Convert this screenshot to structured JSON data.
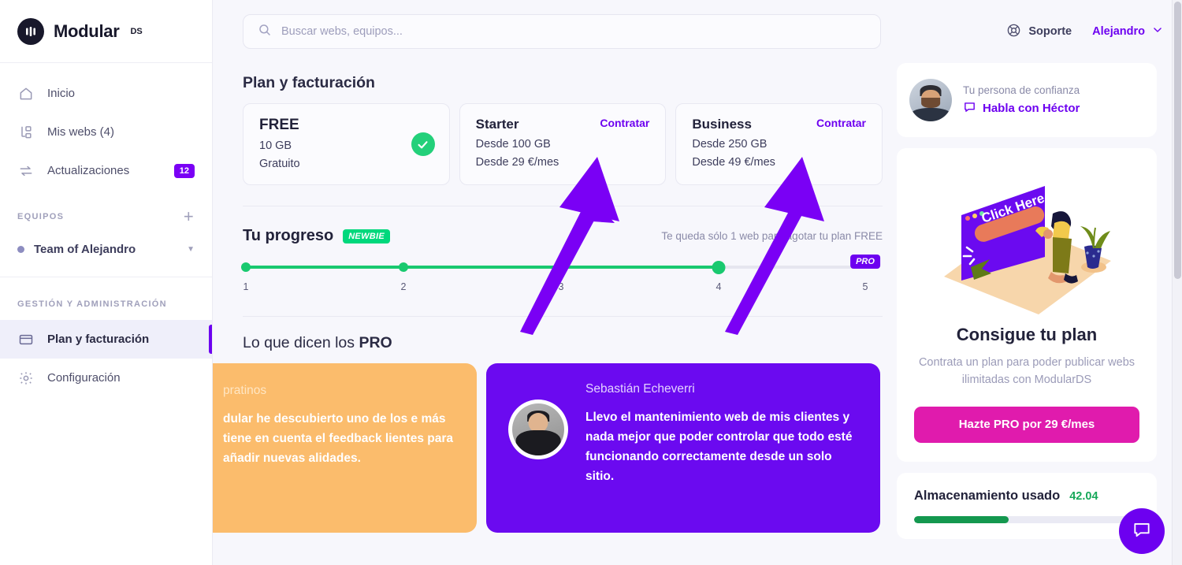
{
  "brand": {
    "name": "Modular",
    "sup": "DS",
    "logo_icon": "modular-logo-icon"
  },
  "sidebar": {
    "nav": [
      {
        "label": "Inicio",
        "icon": "home-icon",
        "badge": null
      },
      {
        "label": "Mis webs (4)",
        "icon": "sites-icon",
        "badge": null
      },
      {
        "label": "Actualizaciones",
        "icon": "updates-icon",
        "badge": "12"
      }
    ],
    "teams_section": {
      "heading": "EQUIPOS",
      "add_icon": "plus-icon"
    },
    "team": {
      "name": "Team of Alejandro",
      "caret_icon": "chevron-down-icon"
    },
    "admin_section": {
      "heading": "GESTIÓN Y ADMINISTRACIÓN"
    },
    "admin_items": [
      {
        "label": "Plan y facturación",
        "icon": "credit-card-icon",
        "active": true
      },
      {
        "label": "Configuración",
        "icon": "gear-icon",
        "active": false
      }
    ]
  },
  "topbar": {
    "search": {
      "placeholder": "Buscar webs, equipos...",
      "value": "",
      "icon": "search-icon"
    },
    "support": {
      "label": "Soporte",
      "icon": "lifebuoy-icon"
    },
    "user": {
      "name": "Alejandro",
      "caret_icon": "chevron-down-icon"
    }
  },
  "billing": {
    "title": "Plan y facturación",
    "plans": [
      {
        "name": "FREE",
        "storage": "10 GB",
        "price": "Gratuito",
        "cta": null,
        "current": true,
        "check_icon": "check-circle-icon"
      },
      {
        "name": "Starter",
        "storage": "Desde 100 GB",
        "price": "Desde 29 €/mes",
        "cta": "Contratar",
        "current": false
      },
      {
        "name": "Business",
        "storage": "Desde 250 GB",
        "price": "Desde 49 €/mes",
        "cta": "Contratar",
        "current": false
      }
    ]
  },
  "progress": {
    "title": "Tu progreso",
    "badge": "NEWBIE",
    "note": "Te queda sólo 1 web para agotar tu plan FREE",
    "steps": [
      "1",
      "2",
      "3",
      "4",
      "5"
    ],
    "current_step": 4,
    "total_steps": 5,
    "pro_badge": "PRO"
  },
  "testimonials": {
    "title_prefix": "Lo que dicen los ",
    "title_strong": "PRO",
    "items": [
      {
        "name": "pratinos",
        "quote": "dular he descubierto uno de los e más tiene en cuenta el feedback lientes para añadir nuevas alidades.",
        "color": "#fbbc6c",
        "clipped": true
      },
      {
        "name": "Sebastián Echeverri",
        "quote": "Llevo el mantenimiento web de mis clientes y nada mejor que poder controlar que todo esté funcionando correctamente desde un solo sitio.",
        "color": "#6b0af0",
        "avatar_icon": "avatar"
      }
    ]
  },
  "aside": {
    "helper": {
      "kicker": "Tu persona de confianza",
      "cta": "Habla con Héctor",
      "chat_icon": "chat-bubble-icon",
      "avatar_icon": "avatar"
    },
    "promo": {
      "illustration_label": "Click Here",
      "title": "Consigue tu plan",
      "subtitle": "Contrata un plan para poder publicar webs ilimitadas con ModularDS",
      "button": "Hazte PRO por 29 €/mes"
    },
    "storage": {
      "title": "Almacenamiento usado",
      "value": "42.04",
      "percent": 42.04
    }
  },
  "overlay": {
    "chat_fab_icon": "chat-bubble-icon",
    "annotation_arrows": 2,
    "arrow_color": "#7a00f5"
  },
  "colors": {
    "accent": "#6d00f0",
    "green": "#19c96f",
    "pink": "#e01bad",
    "orange": "#fbbc6c",
    "purple_card": "#6b0af0",
    "page_bg": "#f7f7fc"
  }
}
